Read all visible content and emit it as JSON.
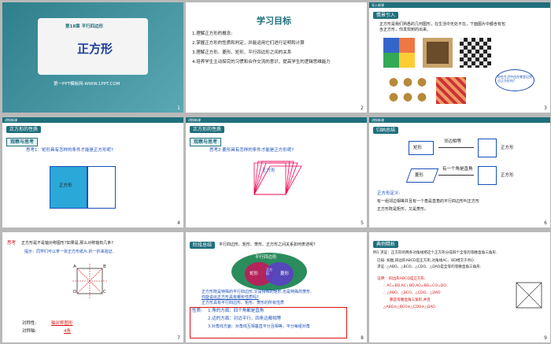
{
  "slides": {
    "s1": {
      "chapter": "第18章 平行四边形",
      "title": "正方形",
      "footer": "第一PPT模板网-WWW.1PPT.COM",
      "num": "1"
    },
    "s2": {
      "title": "学习目标",
      "items": [
        "1.理解正方形的概念;",
        "2.掌握正方形的性质和判定，并能运用它们进行证明和计算",
        "3.理解正方形、菱形、矩形、平行四边形之间的关系",
        "4.培养学生主动探究的习惯和合作交流的意识，提高学生的逻辑思维能力"
      ],
      "num": "2"
    },
    "s3": {
      "bar": "导入新课",
      "tag": "情景引入",
      "text1": "正方形是我们熟悉的几何图形，在生活中无处不在，下面图片中都含有包",
      "text2": "含正方形，你发现到的出来。",
      "bubble": "你在生活中还在哪里见到过正方形吗?",
      "num": "3"
    },
    "s4": {
      "bar": "讲授新课",
      "section": "正方形的性质",
      "tag": "观察与思考",
      "q": "思考1：矩形具有怎样的条件才能是正方形呢?",
      "shape": "正方形",
      "num": "4"
    },
    "s5": {
      "bar": "讲授新课",
      "section": "正方形的性质",
      "tag": "观察与思考",
      "q": "思考2  菱形具有怎样的条件才能是正方形呢?",
      "shape": "正方形",
      "num": "5"
    },
    "s6": {
      "bar": "讲授新课",
      "tag": "归纳总结",
      "rect": "矩形",
      "rhombus": "菱形",
      "sq1": "正方形",
      "sq2": "正方形",
      "arrow1": "邻边相等",
      "arrow2": "有一个角是直角",
      "deflabel": "正方形定义:",
      "def": "有一组邻边相等并且有一个角是直角的平行四边形叫正方形",
      "note": "正方形既是矩形，又是菱形。",
      "num": "6"
    },
    "s7": {
      "q_label": "思考",
      "q": "正方形是不是轴对称图形?如果是,那么对称轴有几条?",
      "hint": "提示：同学们可以拿一张正方形纸片,折一折来验证.",
      "A": "A",
      "B": "B",
      "C": "C",
      "D": "D",
      "sym_label": "对称性:",
      "sym_value": "轴对称图形",
      "axis_label": "对称轴:",
      "axis_value": "4条",
      "num": "7"
    },
    "s8": {
      "tag": "阶段总结",
      "q": "平行四边形、矩形、菱形、正方形之间关系如何表述呢?",
      "outer": "平行四边形",
      "left": "矩形",
      "mid": "正方形",
      "right": "菱形",
      "t1": "正方形既是特殊的平行四边形,又是特殊的矩形,也是特殊的菱形.",
      "t2": "你能说出正方形具有哪些性质吗?",
      "t3": "正方形具有平行四边形、矩形、菱形的所有性质",
      "p0": "性质:",
      "p1": "1.角的方面：四个角都是直角",
      "p2": "2.边的方面：对边平行，四条边都相等",
      "p3": "3.对角线方面：对角线互相垂直平分且相等，平分每组对角",
      "num": "8"
    },
    "s9": {
      "tag": "典例精析",
      "ex": "例1  求证：正方形的两条对角线把这个正方形分成四个全等的等腰直角三角形.",
      "given": "已知: 如图,四边形ABCD是正方形,对角线AC、BD相交于点O.",
      "prove": "求证: △ABO、△BCO、△CDO、△DAO是全等的等腰直角三角形.",
      "proof": "证明: ∵四边形ABCD是正方形,",
      "l1": "∴ AC=BD,AC⊥BD,AO=BO=CO=DO.",
      "l2": "∴ △ABO、△BCO、△CDO、△DAO",
      "l3": "都是等腰直角三角形,并且",
      "l4": "△ABO≌△BCO≌△CDO≌△DAO.",
      "num": "9"
    }
  }
}
